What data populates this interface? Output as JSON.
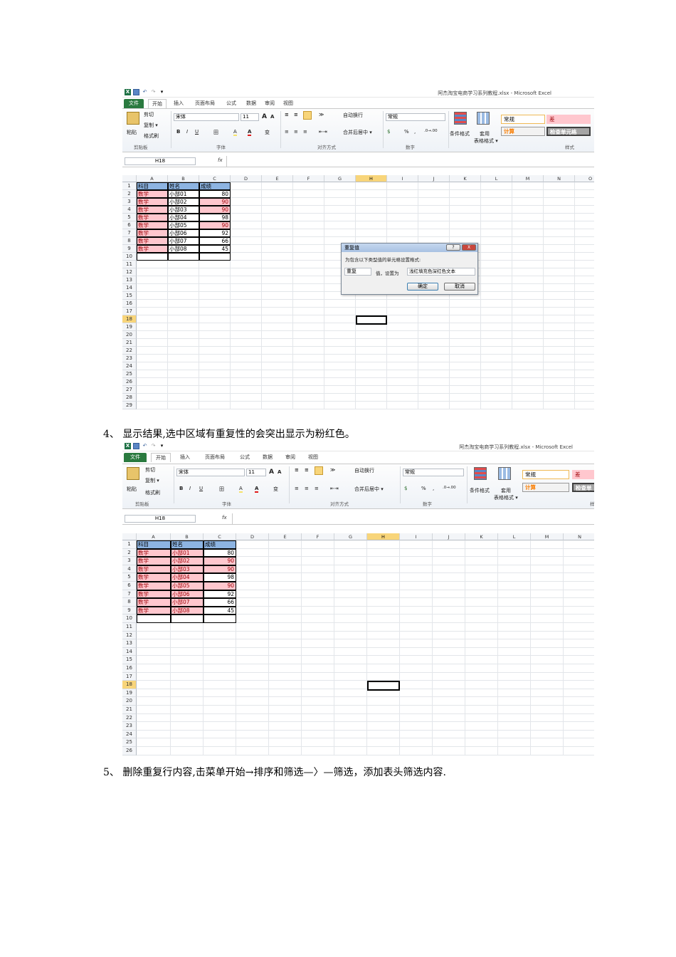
{
  "window_title": "阿杰淘宝电商学习系列教程.xlsx - Microsoft Excel",
  "qat": {
    "excel_icon": "X",
    "save_icon": "save-icon",
    "undo_icon": "undo-icon",
    "redo_icon": "redo-icon",
    "customize": "▾"
  },
  "tabs": [
    "文件",
    "开始",
    "插入",
    "页面布局",
    "公式",
    "数据",
    "审阅",
    "视图"
  ],
  "ribbon": {
    "paste": "粘贴",
    "cut": "剪切",
    "copy": "复制 ▾",
    "format_painter": "格式刷",
    "clipboard": "剪贴板",
    "font_name": "宋体",
    "font_size": "11",
    "grow_font": "A",
    "shrink_font": "A",
    "bold": "B",
    "italic": "I",
    "underline": "U",
    "border_btn": "田",
    "fill_btn": "A",
    "wen": "变",
    "font_group": "字体",
    "wrap_text": "自动换行",
    "merge_center": "合并后居中 ▾",
    "align_group": "对齐方式",
    "number_format": "常规",
    "percent": "%",
    "comma": ",",
    "inc_decimal": ".0→.00",
    "dec_decimal": ".00→.0",
    "number_group": "数字",
    "cond_format": "条件格式",
    "table_format_1": "套用",
    "table_format_2": "表格格式 ▾",
    "style_normal": "常规",
    "style_bad": "差",
    "style_calc": "计算",
    "style_check": "检查单元格",
    "style_check_cut": "检查单",
    "styles_group": "样式",
    "styles_group_cut": "样"
  },
  "namebox": "H18",
  "fx": "fx",
  "columns": [
    "A",
    "B",
    "C",
    "D",
    "E",
    "F",
    "G",
    "H",
    "I",
    "J",
    "K",
    "L",
    "M",
    "N",
    "O"
  ],
  "table": {
    "headers": [
      "科目",
      "姓名",
      "成绩"
    ],
    "rows": [
      [
        "数学",
        "小部01",
        "80"
      ],
      [
        "数学",
        "小部02",
        "90"
      ],
      [
        "数学",
        "小部03",
        "90"
      ],
      [
        "数学",
        "小部04",
        "98"
      ],
      [
        "数学",
        "小部05",
        "90"
      ],
      [
        "数学",
        "小部06",
        "92"
      ],
      [
        "数学",
        "小部07",
        "66"
      ],
      [
        "数学",
        "小部08",
        "45"
      ]
    ]
  },
  "dialog": {
    "title": "重复值",
    "help": "?",
    "close": "X",
    "prompt": "为包含以下类型值的单元格设置格式:",
    "type_value": "重复",
    "value_label": "值，设置为",
    "format_value": "浅红填充色深红色文本",
    "ok": "确定",
    "cancel": "取消"
  },
  "step4": "4、 显示结果,选中区域有重复性的会突出显示为粉红色。",
  "step5": "5、 删除重复行内容,击菜单开始→排序和筛选—〉—筛选，添加表头筛选内容."
}
